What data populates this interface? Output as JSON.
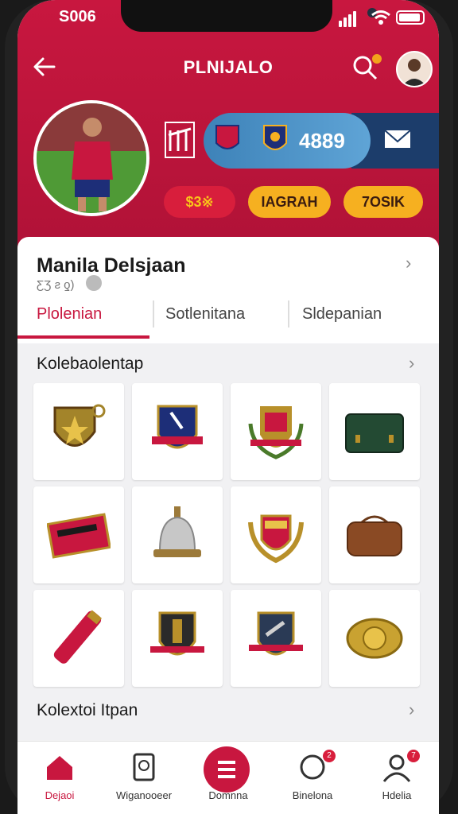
{
  "status_bar": {
    "time": "S006"
  },
  "header": {
    "title": "PLNIJALO"
  },
  "stats": {
    "score": "4889"
  },
  "chips": {
    "money": "$3※",
    "a": "IAGRAH",
    "b": "7OSIK"
  },
  "profile": {
    "name": "Manila Delsjaan",
    "subtitle": "ƸƷ ƨ ƍ)"
  },
  "tabs": [
    "Plolenian",
    "Sotlenitana",
    "Sldepanian"
  ],
  "sections": {
    "collection_1": "Kolebaolentap",
    "collection_2": "Kolextoi Itpan"
  },
  "items": [
    "pendant-shield-icon",
    "club-crest-icon",
    "wreath-crest-icon",
    "green-case-icon",
    "flag-banner-icon",
    "bell-trophy-icon",
    "laurel-crest-icon",
    "brown-bag-icon",
    "scarf-roll-icon",
    "gold-crest-icon",
    "blue-crest-icon",
    "gold-emblem-icon"
  ],
  "nav": [
    {
      "label": "Dejaoi",
      "icon": "home-icon",
      "badge": ""
    },
    {
      "label": "Wiganooeer",
      "icon": "tablet-icon",
      "badge": ""
    },
    {
      "label": "Domnna",
      "icon": "list-icon",
      "badge": ""
    },
    {
      "label": "Binelona",
      "icon": "chat-icon",
      "badge": "2"
    },
    {
      "label": "Hdelia",
      "icon": "person-icon",
      "badge": "7"
    }
  ],
  "colors": {
    "primary": "#c8173f",
    "accent": "#f6b020",
    "score_pill": "#5fa4d6"
  }
}
